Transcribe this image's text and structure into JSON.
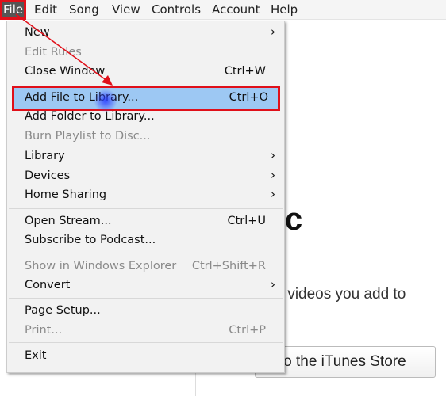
{
  "menubar": {
    "items": [
      "File",
      "Edit",
      "Song",
      "View",
      "Controls",
      "Account",
      "Help"
    ]
  },
  "file_menu": {
    "items": [
      {
        "label": "New",
        "shortcut": "",
        "submenu": true,
        "disabled": false
      },
      {
        "label": "Edit Rules",
        "shortcut": "",
        "submenu": false,
        "disabled": true
      },
      {
        "label": "Close Window",
        "shortcut": "Ctrl+W",
        "submenu": false,
        "disabled": false
      },
      {
        "label": "Add File to Library...",
        "shortcut": "Ctrl+O",
        "submenu": false,
        "disabled": false,
        "highlighted": true
      },
      {
        "label": "Add Folder to Library...",
        "shortcut": "",
        "submenu": false,
        "disabled": false
      },
      {
        "label": "Burn Playlist to Disc...",
        "shortcut": "",
        "submenu": false,
        "disabled": true
      },
      {
        "label": "Library",
        "shortcut": "",
        "submenu": true,
        "disabled": false
      },
      {
        "label": "Devices",
        "shortcut": "",
        "submenu": true,
        "disabled": false
      },
      {
        "label": "Home Sharing",
        "shortcut": "",
        "submenu": true,
        "disabled": false
      },
      {
        "label": "Open Stream...",
        "shortcut": "Ctrl+U",
        "submenu": false,
        "disabled": false
      },
      {
        "label": "Subscribe to Podcast...",
        "shortcut": "",
        "submenu": false,
        "disabled": false
      },
      {
        "label": "Show in Windows Explorer",
        "shortcut": "Ctrl+Shift+R",
        "submenu": false,
        "disabled": true
      },
      {
        "label": "Convert",
        "shortcut": "",
        "submenu": true,
        "disabled": false
      },
      {
        "label": "Page Setup...",
        "shortcut": "",
        "submenu": false,
        "disabled": false
      },
      {
        "label": "Print...",
        "shortcut": "Ctrl+P",
        "submenu": false,
        "disabled": true
      },
      {
        "label": "Exit",
        "shortcut": "",
        "submenu": false,
        "disabled": false
      }
    ]
  },
  "content": {
    "title": "lusic",
    "subtitle": "gs and videos you add to",
    "store_button": "o to the iTunes Store"
  },
  "colors": {
    "highlight": "#9dc8f3",
    "annotation": "#e0101a"
  }
}
